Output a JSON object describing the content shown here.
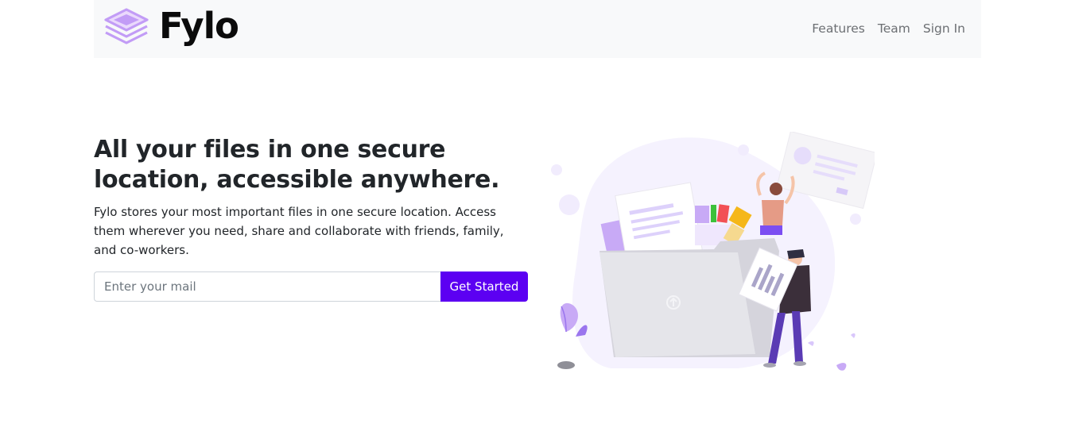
{
  "nav": {
    "brand_name": "Fylo",
    "logo_icon": "stacked-layers-icon",
    "links": [
      {
        "label": "Features"
      },
      {
        "label": "Team"
      },
      {
        "label": "Sign In"
      }
    ]
  },
  "hero": {
    "title": "All your files in one secure location, accessible anywhere.",
    "lead": "Fylo stores your most important files in one secure location. Access them wherever you need, share and collaborate with friends, family, and co-workers.",
    "email_placeholder": "Enter your mail",
    "cta_label": "Get Started",
    "illustration_icon": "file-sharing-illustration"
  },
  "colors": {
    "accent": "#5c00f2",
    "logo_purple": "#c29cf6",
    "navbar_bg": "#f8f9fa"
  }
}
